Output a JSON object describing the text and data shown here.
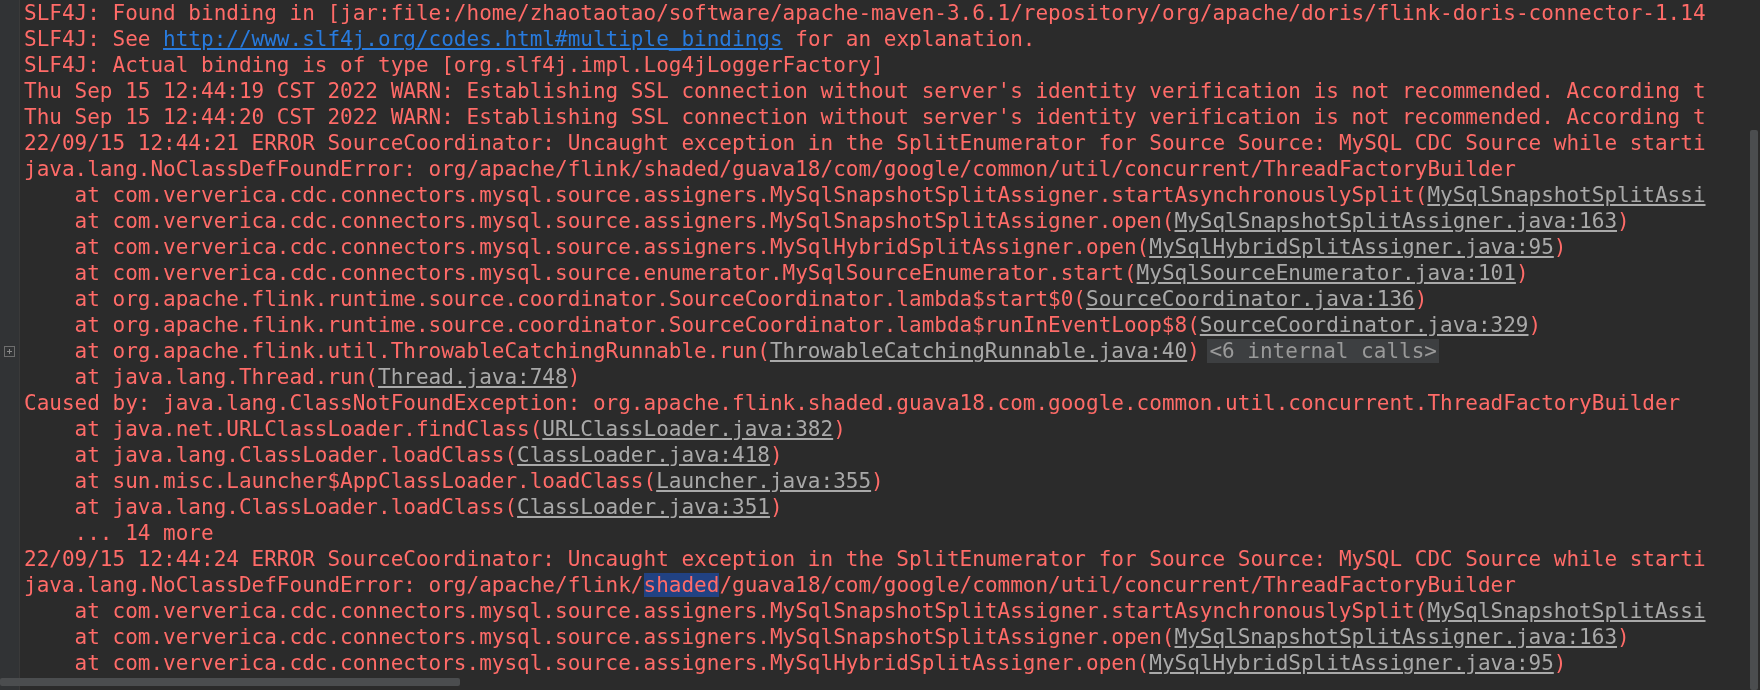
{
  "console": {
    "lines": [
      {
        "indented": false,
        "foldable": false,
        "segments": [
          {
            "kind": "text",
            "text": "SLF4J: Found binding in [jar:file:/home/zhaotaotao/software/apache-maven-3.6.1/repository/org/apache/doris/flink-doris-connector-1.14"
          }
        ]
      },
      {
        "indented": false,
        "foldable": false,
        "segments": [
          {
            "kind": "text",
            "text": "SLF4J: See "
          },
          {
            "kind": "url",
            "text": "http://www.slf4j.org/codes.html#multiple_bindings"
          },
          {
            "kind": "text",
            "text": " for an explanation."
          }
        ]
      },
      {
        "indented": false,
        "foldable": false,
        "segments": [
          {
            "kind": "text",
            "text": "SLF4J: Actual binding is of type [org.slf4j.impl.Log4jLoggerFactory]"
          }
        ]
      },
      {
        "indented": false,
        "foldable": false,
        "segments": [
          {
            "kind": "text",
            "text": "Thu Sep 15 12:44:19 CST 2022 WARN: Establishing SSL connection without server's identity verification is not recommended. According t"
          }
        ]
      },
      {
        "indented": false,
        "foldable": false,
        "segments": [
          {
            "kind": "text",
            "text": "Thu Sep 15 12:44:20 CST 2022 WARN: Establishing SSL connection without server's identity verification is not recommended. According t"
          }
        ]
      },
      {
        "indented": false,
        "foldable": false,
        "segments": [
          {
            "kind": "text",
            "text": "22/09/15 12:44:21 ERROR SourceCoordinator: Uncaught exception in the SplitEnumerator for Source Source: MySQL CDC Source while starti"
          }
        ]
      },
      {
        "indented": false,
        "foldable": false,
        "segments": [
          {
            "kind": "text",
            "text": "java.lang.NoClassDefFoundError: org/apache/flink/shaded/guava18/com/google/common/util/concurrent/ThreadFactoryBuilder"
          }
        ]
      },
      {
        "indented": true,
        "foldable": false,
        "segments": [
          {
            "kind": "text",
            "text": "at com.ververica.cdc.connectors.mysql.source.assigners.MySqlSnapshotSplitAssigner.startAsynchronouslySplit("
          },
          {
            "kind": "source",
            "text": "MySqlSnapshotSplitAssi"
          }
        ]
      },
      {
        "indented": true,
        "foldable": false,
        "segments": [
          {
            "kind": "text",
            "text": "at com.ververica.cdc.connectors.mysql.source.assigners.MySqlSnapshotSplitAssigner.open("
          },
          {
            "kind": "source",
            "text": "MySqlSnapshotSplitAssigner.java:163"
          },
          {
            "kind": "text",
            "text": ")"
          }
        ]
      },
      {
        "indented": true,
        "foldable": false,
        "segments": [
          {
            "kind": "text",
            "text": "at com.ververica.cdc.connectors.mysql.source.assigners.MySqlHybridSplitAssigner.open("
          },
          {
            "kind": "source",
            "text": "MySqlHybridSplitAssigner.java:95"
          },
          {
            "kind": "text",
            "text": ")"
          }
        ]
      },
      {
        "indented": true,
        "foldable": false,
        "segments": [
          {
            "kind": "text",
            "text": "at com.ververica.cdc.connectors.mysql.source.enumerator.MySqlSourceEnumerator.start("
          },
          {
            "kind": "source",
            "text": "MySqlSourceEnumerator.java:101"
          },
          {
            "kind": "text",
            "text": ")"
          }
        ]
      },
      {
        "indented": true,
        "foldable": false,
        "segments": [
          {
            "kind": "text",
            "text": "at org.apache.flink.runtime.source.coordinator.SourceCoordinator.lambda$start$0("
          },
          {
            "kind": "source",
            "text": "SourceCoordinator.java:136"
          },
          {
            "kind": "text",
            "text": ")"
          }
        ]
      },
      {
        "indented": true,
        "foldable": false,
        "segments": [
          {
            "kind": "text",
            "text": "at org.apache.flink.runtime.source.coordinator.SourceCoordinator.lambda$runInEventLoop$8("
          },
          {
            "kind": "source",
            "text": "SourceCoordinator.java:329"
          },
          {
            "kind": "text",
            "text": ")"
          }
        ]
      },
      {
        "indented": true,
        "foldable": true,
        "segments": [
          {
            "kind": "text",
            "text": "at org.apache.flink.util.ThrowableCatchingRunnable.run("
          },
          {
            "kind": "source",
            "text": "ThrowableCatchingRunnable.java:40"
          },
          {
            "kind": "text",
            "text": ")"
          },
          {
            "kind": "folded",
            "text": "<6 internal calls>"
          }
        ]
      },
      {
        "indented": true,
        "foldable": false,
        "segments": [
          {
            "kind": "text",
            "text": "at java.lang.Thread.run("
          },
          {
            "kind": "source",
            "text": "Thread.java:748"
          },
          {
            "kind": "text",
            "text": ")"
          }
        ]
      },
      {
        "indented": false,
        "foldable": false,
        "segments": [
          {
            "kind": "text",
            "text": "Caused by: java.lang.ClassNotFoundException: org.apache.flink.shaded.guava18.com.google.common.util.concurrent.ThreadFactoryBuilder"
          }
        ]
      },
      {
        "indented": true,
        "foldable": false,
        "segments": [
          {
            "kind": "text",
            "text": "at java.net.URLClassLoader.findClass("
          },
          {
            "kind": "source",
            "text": "URLClassLoader.java:382"
          },
          {
            "kind": "text",
            "text": ")"
          }
        ]
      },
      {
        "indented": true,
        "foldable": false,
        "segments": [
          {
            "kind": "text",
            "text": "at java.lang.ClassLoader.loadClass("
          },
          {
            "kind": "source",
            "text": "ClassLoader.java:418"
          },
          {
            "kind": "text",
            "text": ")"
          }
        ]
      },
      {
        "indented": true,
        "foldable": false,
        "segments": [
          {
            "kind": "text",
            "text": "at sun.misc.Launcher$AppClassLoader.loadClass("
          },
          {
            "kind": "source",
            "text": "Launcher.java:355"
          },
          {
            "kind": "text",
            "text": ")"
          }
        ]
      },
      {
        "indented": true,
        "foldable": false,
        "segments": [
          {
            "kind": "text",
            "text": "at java.lang.ClassLoader.loadClass("
          },
          {
            "kind": "source",
            "text": "ClassLoader.java:351"
          },
          {
            "kind": "text",
            "text": ")"
          }
        ]
      },
      {
        "indented": true,
        "foldable": false,
        "segments": [
          {
            "kind": "text",
            "text": "... 14 more"
          }
        ]
      },
      {
        "indented": false,
        "foldable": false,
        "segments": [
          {
            "kind": "text",
            "text": "22/09/15 12:44:24 ERROR SourceCoordinator: Uncaught exception in the SplitEnumerator for Source Source: MySQL CDC Source while starti"
          }
        ]
      },
      {
        "indented": false,
        "foldable": false,
        "segments": [
          {
            "kind": "text",
            "text": "java.lang.NoClassDefFoundError: org/apache/flink/"
          },
          {
            "kind": "match",
            "text": "shaded"
          },
          {
            "kind": "text",
            "text": "/guava18/com/google/common/util/concurrent/ThreadFactoryBuilder"
          }
        ]
      },
      {
        "indented": true,
        "foldable": false,
        "segments": [
          {
            "kind": "text",
            "text": "at com.ververica.cdc.connectors.mysql.source.assigners.MySqlSnapshotSplitAssigner.startAsynchronouslySplit("
          },
          {
            "kind": "source",
            "text": "MySqlSnapshotSplitAssi"
          }
        ]
      },
      {
        "indented": true,
        "foldable": false,
        "segments": [
          {
            "kind": "text",
            "text": "at com.ververica.cdc.connectors.mysql.source.assigners.MySqlSnapshotSplitAssigner.open("
          },
          {
            "kind": "source",
            "text": "MySqlSnapshotSplitAssigner.java:163"
          },
          {
            "kind": "text",
            "text": ")"
          }
        ]
      },
      {
        "indented": true,
        "foldable": false,
        "segments": [
          {
            "kind": "text",
            "text": "at com.ververica.cdc.connectors.mysql.source.assigners.MySqlHybridSplitAssigner.open("
          },
          {
            "kind": "source",
            "text": "MySqlHybridSplitAssigner.java:95"
          },
          {
            "kind": "text",
            "text": ")"
          }
        ]
      }
    ]
  }
}
